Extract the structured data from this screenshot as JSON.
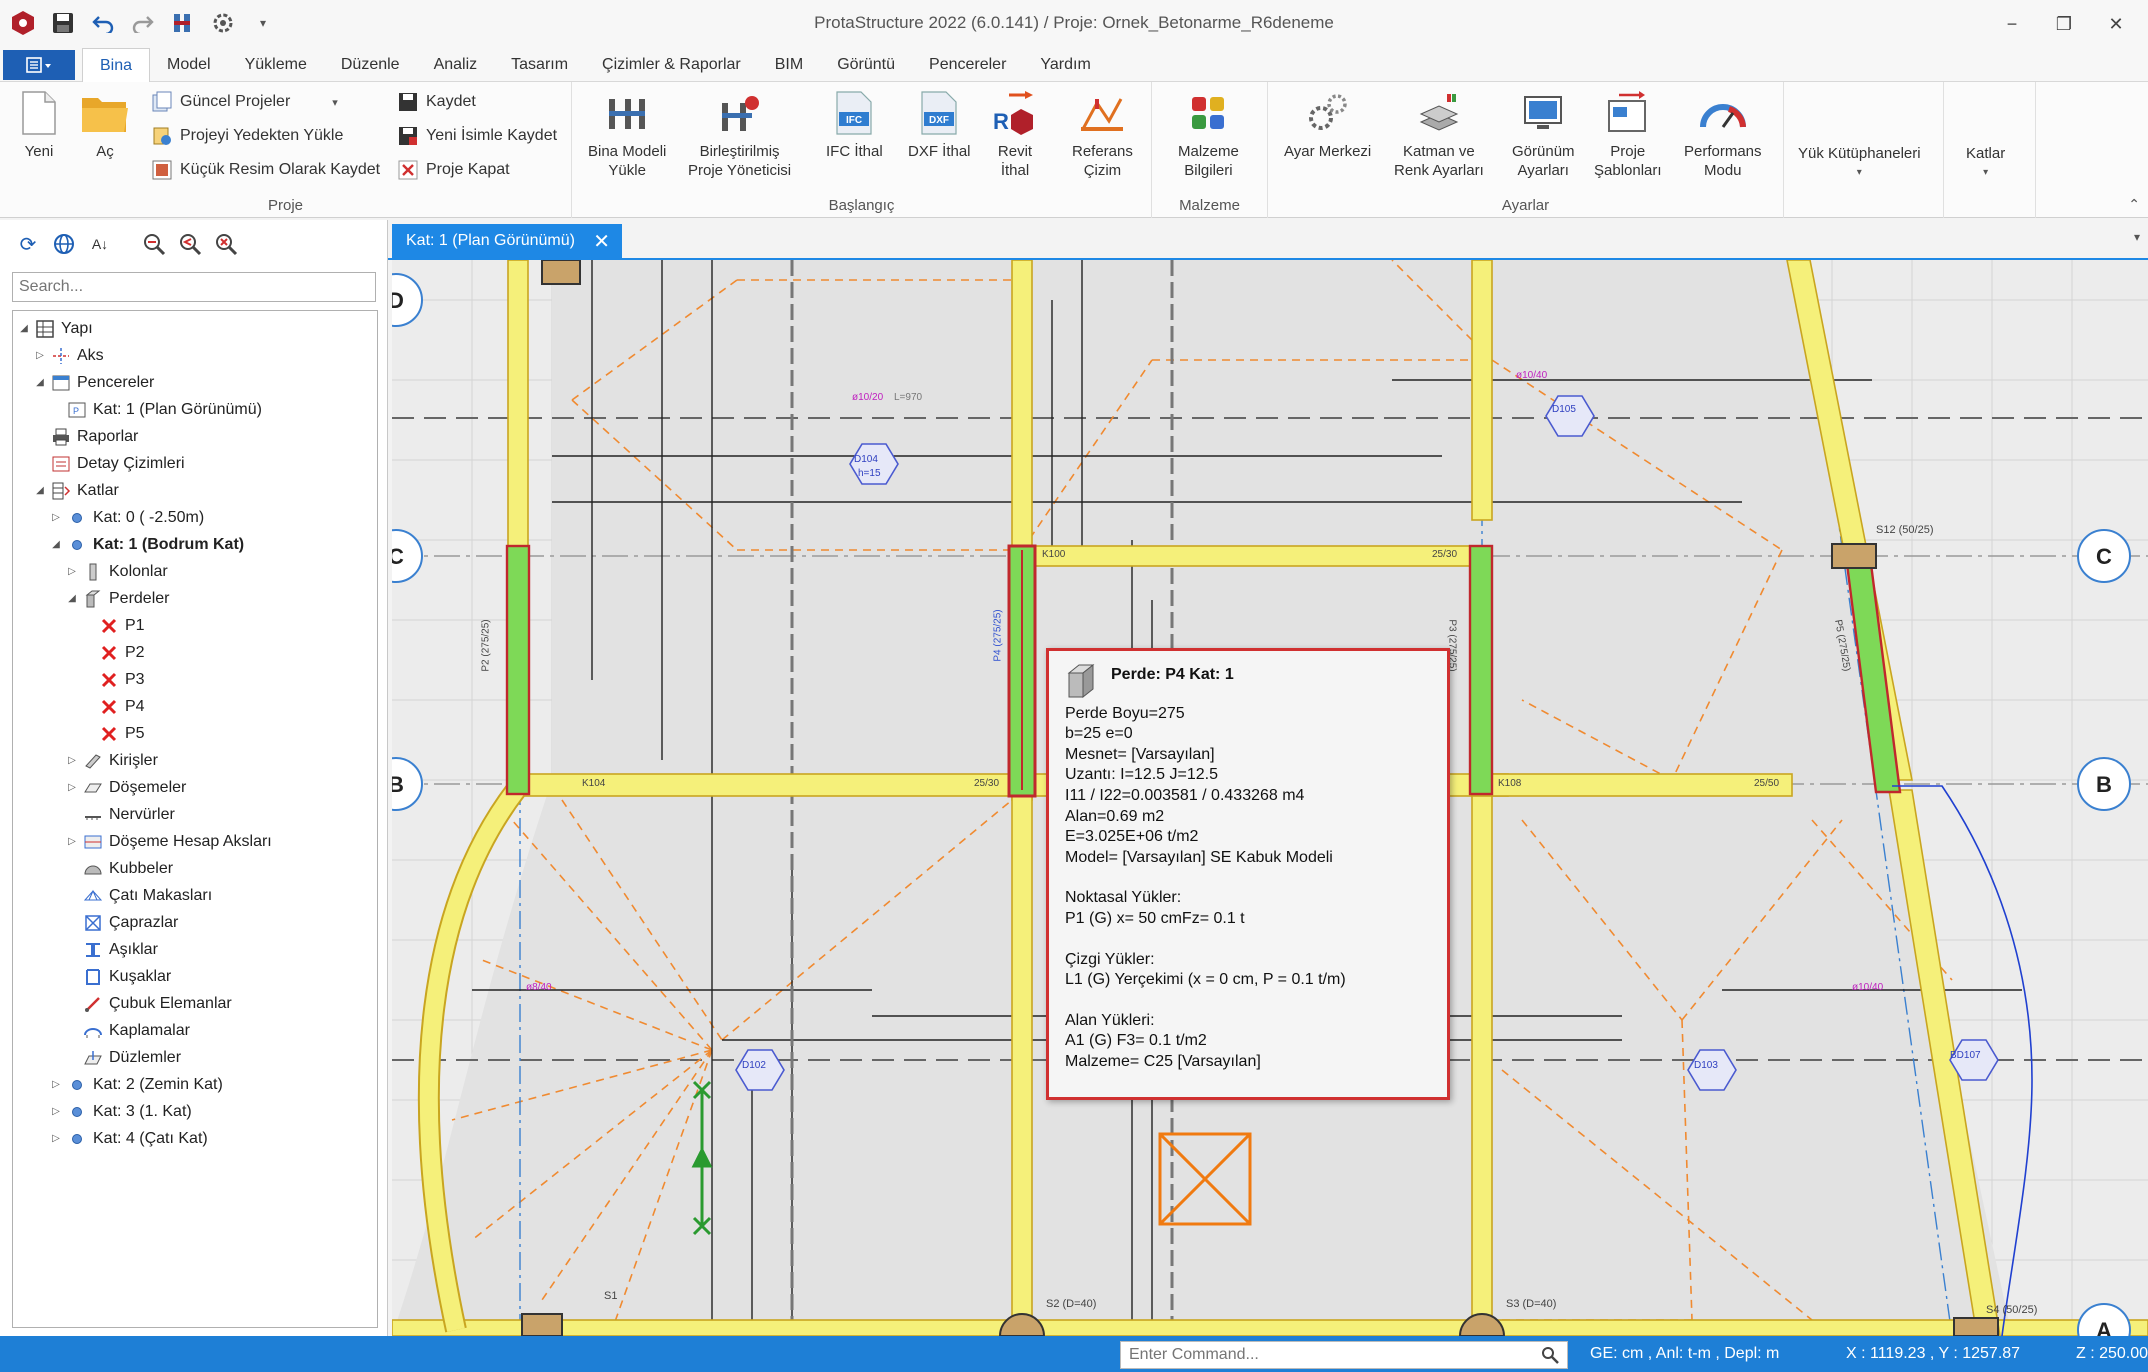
{
  "window": {
    "title": "ProtaStructure 2022 (6.0.141) / Proje: Ornek_Betonarme_R6deneme",
    "minimize": "−",
    "restore": "❐",
    "close": "✕"
  },
  "menu": {
    "tabs": [
      "Bina",
      "Model",
      "Yükleme",
      "Düzenle",
      "Analiz",
      "Tasarım",
      "Çizimler & Raporlar",
      "BIM",
      "Görüntü",
      "Pencereler",
      "Yardım"
    ]
  },
  "ribbon": {
    "proje": {
      "label": "Proje",
      "yeni": "Yeni",
      "ac": "Aç",
      "guncel": "Güncel Projeler",
      "yedekten": "Projeyi Yedekten Yükle",
      "kucuk": "Küçük Resim Olarak Kaydet",
      "kaydet": "Kaydet",
      "yeni_isim": "Yeni İsimle Kaydet",
      "kapat": "Proje Kapat"
    },
    "baslangic": {
      "label": "Başlangıç",
      "bina_modeli_1": "Bina Modeli",
      "bina_modeli_2": "Yükle",
      "birlestirilmis_1": "Birleştirilmiş",
      "birlestirilmis_2": "Proje Yöneticisi",
      "ifc": "IFC İthal",
      "dxf": "DXF İthal",
      "revit_1": "Revit",
      "revit_2": "İthal",
      "referans_1": "Referans",
      "referans_2": "Çizim"
    },
    "malzeme": {
      "label": "Malzeme",
      "b1": "Malzeme",
      "b2": "Bilgileri"
    },
    "ayarlar": {
      "label": "Ayarlar",
      "ayar_merkezi": "Ayar Merkezi",
      "katman_1": "Katman ve",
      "katman_2": "Renk Ayarları",
      "gorunum_1": "Görünüm",
      "gorunum_2": "Ayarları",
      "sablon_1": "Proje",
      "sablon_2": "Şablonları",
      "perf_1": "Performans",
      "perf_2": "Modu"
    },
    "yuk_kutuphane": "Yük Kütüphaneleri",
    "katlar": "Katlar"
  },
  "panel": {
    "search_placeholder": "Search...",
    "tree": [
      {
        "label": "Yapı",
        "level": 0,
        "exp": "◢",
        "icon": "building"
      },
      {
        "label": "Aks",
        "level": 1,
        "exp": "▷",
        "icon": "axis"
      },
      {
        "label": "Pencereler",
        "level": 1,
        "exp": "◢",
        "icon": "window"
      },
      {
        "label": "Kat: 1 (Plan Görünümü)",
        "level": 2,
        "exp": "",
        "icon": "plan"
      },
      {
        "label": "Raporlar",
        "level": 1,
        "exp": "",
        "icon": "printer"
      },
      {
        "label": "Detay Çizimleri",
        "level": 1,
        "exp": "",
        "icon": "detail"
      },
      {
        "label": "Katlar",
        "level": 1,
        "exp": "◢",
        "icon": "floors"
      },
      {
        "label": "Kat: 0 ( -2.50m)",
        "level": 2,
        "exp": "▷",
        "icon": "dot"
      },
      {
        "label": "Kat: 1 (Bodrum Kat)",
        "level": 2,
        "exp": "◢",
        "icon": "dot",
        "bold": true
      },
      {
        "label": "Kolonlar",
        "level": 3,
        "exp": "▷",
        "icon": "column"
      },
      {
        "label": "Perdeler",
        "level": 3,
        "exp": "◢",
        "icon": "wall"
      },
      {
        "label": "P1",
        "level": 4,
        "exp": "",
        "icon": "xred"
      },
      {
        "label": "P2",
        "level": 4,
        "exp": "",
        "icon": "xred"
      },
      {
        "label": "P3",
        "level": 4,
        "exp": "",
        "icon": "xred"
      },
      {
        "label": "P4",
        "level": 4,
        "exp": "",
        "icon": "xred"
      },
      {
        "label": "P5",
        "level": 4,
        "exp": "",
        "icon": "xred"
      },
      {
        "label": "Kirişler",
        "level": 3,
        "exp": "▷",
        "icon": "beam"
      },
      {
        "label": "Döşemeler",
        "level": 3,
        "exp": "▷",
        "icon": "slab"
      },
      {
        "label": "Nervürler",
        "level": 3,
        "exp": "",
        "icon": "rib"
      },
      {
        "label": "Döşeme Hesap Aksları",
        "level": 3,
        "exp": "▷",
        "icon": "slabaxis"
      },
      {
        "label": "Kubbeler",
        "level": 3,
        "exp": "",
        "icon": "dome"
      },
      {
        "label": "Çatı Makasları",
        "level": 3,
        "exp": "",
        "icon": "truss"
      },
      {
        "label": "Çaprazlar",
        "level": 3,
        "exp": "",
        "icon": "brace"
      },
      {
        "label": "Aşıklar",
        "level": 3,
        "exp": "",
        "icon": "purlin"
      },
      {
        "label": "Kuşaklar",
        "level": 3,
        "exp": "",
        "icon": "girt"
      },
      {
        "label": "Çubuk Elemanlar",
        "level": 3,
        "exp": "",
        "icon": "bar"
      },
      {
        "label": "Kaplamalar",
        "level": 3,
        "exp": "",
        "icon": "cladding"
      },
      {
        "label": "Düzlemler",
        "level": 3,
        "exp": "",
        "icon": "plane"
      },
      {
        "label": "Kat: 2 (Zemin Kat)",
        "level": 2,
        "exp": "▷",
        "icon": "dot"
      },
      {
        "label": "Kat: 3 (1. Kat)",
        "level": 2,
        "exp": "▷",
        "icon": "dot"
      },
      {
        "label": "Kat: 4 (Çatı Kat)",
        "level": 2,
        "exp": "▷",
        "icon": "dot"
      }
    ]
  },
  "doc_tab": {
    "label": "Kat: 1 (Plan Görünümü)"
  },
  "plan": {
    "axis_labels": {
      "d_left": "D",
      "c_left": "C",
      "b_left": "B",
      "c_right": "C",
      "b_right": "B",
      "a_right": "A"
    },
    "labels": {
      "k100": "K100",
      "k105": "K105",
      "k104": "K104",
      "k108": "K108",
      "dim25_30": "25/30",
      "dim25_50_a": "25/30",
      "dim25_50_b": "25/50",
      "s12": "S12 (50/25)",
      "s2": "S2 (D=40)",
      "s3": "S3 (D=40)",
      "s1": "S1",
      "s4": "S4 (50/25)",
      "p2": "P2 (275/25)",
      "p3": "P3 (275/25)",
      "p5": "P5 (275/25)",
      "p4": "P4 (275/25)",
      "d105": "D105",
      "d104": "D104",
      "d103": "D103",
      "d102": "D102",
      "bd107": "BD107",
      "hf15": "h=15",
      "r1": "ø10/40",
      "r2": "ø10/20",
      "r3": "ø8/40",
      "r4": "L=970"
    }
  },
  "tooltip": {
    "title": "Perde: P4 Kat: 1",
    "lines1": [
      "Perde Boyu=275",
      "b=25  e=0",
      "Mesnet= [Varsayılan]",
      "Uzantı: I=12.5  J=12.5",
      "I11 / I22=0.003581 / 0.433268 m4",
      "Alan=0.69 m2",
      "E=3.025E+06 t/m2",
      "Model= [Varsayılan] SE Kabuk Modeli"
    ],
    "lines2": [
      "Noktasal Yükler:",
      "P1  (G) x= 50 cmFz= 0.1 t"
    ],
    "lines3": [
      "Çizgi Yükler:",
      "L1  (G)  Yerçekimi (x = 0 cm, P = 0.1 t/m)"
    ],
    "lines4": [
      "Alan Yükleri:",
      "A1  (G) F3= 0.1 t/m2",
      "Malzeme= C25 [Varsayılan]"
    ]
  },
  "status": {
    "command_placeholder": "Enter Command...",
    "units": "GE: cm , Anl: t-m , Depl: m",
    "coords": "X : 1119.23 , Y : 1257.87",
    "zoom": "Z : 250.00 cm"
  },
  "colors": {
    "accent": "#1e7fd6",
    "beam_yellow": "#f5f07a",
    "wall_green": "#7ed957",
    "wall_border": "#c0282d"
  }
}
